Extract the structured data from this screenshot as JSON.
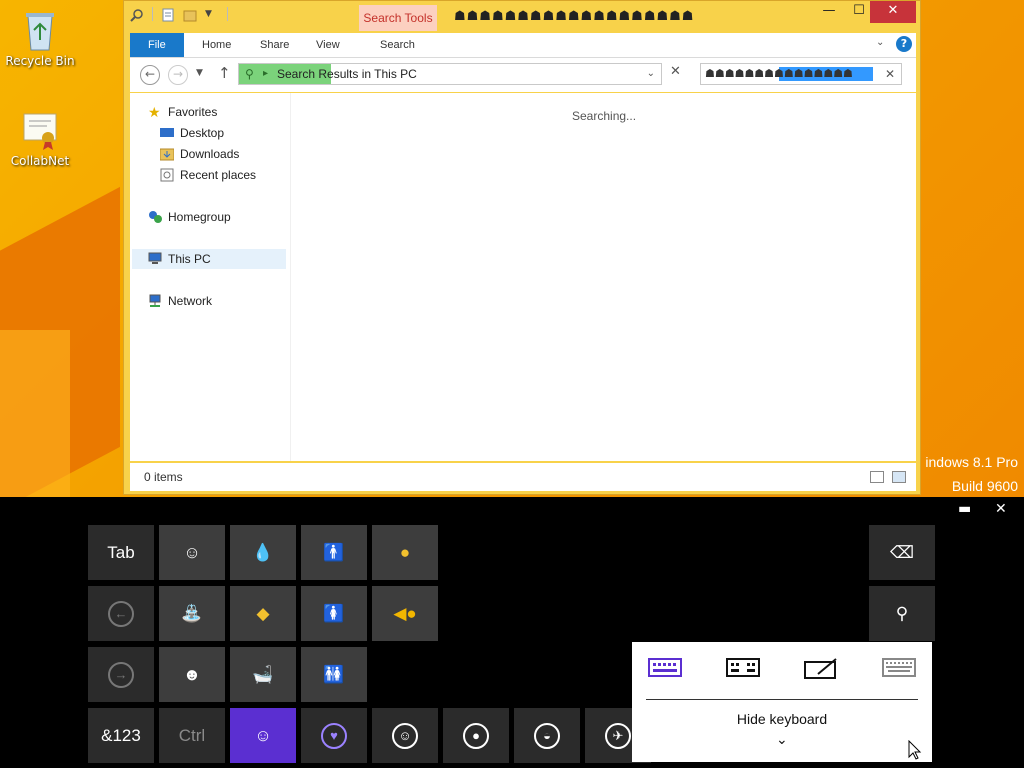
{
  "desktop": {
    "icons": [
      {
        "label": "Recycle Bin"
      },
      {
        "label": "CollabNet"
      }
    ],
    "watermark": {
      "line1": "indows 8.1 Pro",
      "line2": "Build 9600"
    }
  },
  "explorer": {
    "contextual_tab": "Search Tools",
    "title_glyphs": "☗☗☗☗☗☗☗☗☗☗☗☗☗☗☗☗☗☗☗",
    "ribbon_tabs": [
      "File",
      "Home",
      "Share",
      "View",
      "Search"
    ],
    "address": "Search Results in This PC",
    "search_query_glyphs": "☗☗☗☗☗☗☗☗☗☗☗☗☗☗☗",
    "nav": {
      "favorites": "Favorites",
      "desktop": "Desktop",
      "downloads": "Downloads",
      "recent": "Recent places",
      "homegroup": "Homegroup",
      "this_pc": "This PC",
      "network": "Network"
    },
    "status_message": "Searching...",
    "item_count": "0 items"
  },
  "keyboard": {
    "row1": [
      "Tab"
    ],
    "row4": [
      "&123",
      "Ctrl"
    ],
    "hide_label": "Hide keyboard"
  },
  "colors": {
    "accent": "#1979ca",
    "keyboard_accent": "#5b2fd1",
    "close_red": "#c7333a"
  }
}
